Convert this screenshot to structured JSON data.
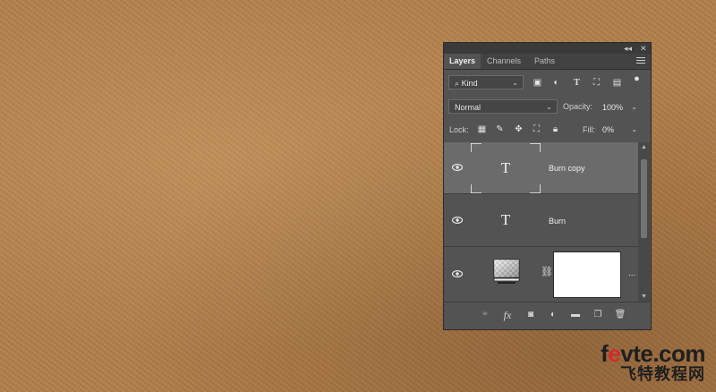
{
  "panel": {
    "tabs": [
      "Layers",
      "Channels",
      "Paths"
    ],
    "active_tab": "Layers",
    "filter_kind": "Kind",
    "blend_mode": "Normal",
    "opacity_label": "Opacity:",
    "opacity_value": "100%",
    "lock_label": "Lock:",
    "fill_label": "Fill:",
    "fill_value": "0%",
    "layers": [
      {
        "name": "Burn copy",
        "type": "text",
        "thumb_glyph": "T",
        "selected": true
      },
      {
        "name": "Burn",
        "type": "text",
        "thumb_glyph": "T",
        "selected": false
      },
      {
        "name": "",
        "type": "adjustment",
        "selected": false,
        "more": "..."
      }
    ],
    "footer_icons": [
      "link-layers-icon",
      "fx-icon",
      "add-mask-icon",
      "adjustment-layer-icon",
      "new-group-icon",
      "new-layer-icon",
      "delete-layer-icon"
    ],
    "fx_label": "fx"
  },
  "watermark": {
    "line1_prefix": "f",
    "line1_accent": "e",
    "line1_suffix": "vte.com",
    "line2": "飞特教程网"
  },
  "colors": {
    "canvas_bg": "#b07d48",
    "panel_bg": "#535353",
    "selected_layer": "#6b6b6b",
    "watermark_accent": "#d42a2a"
  }
}
